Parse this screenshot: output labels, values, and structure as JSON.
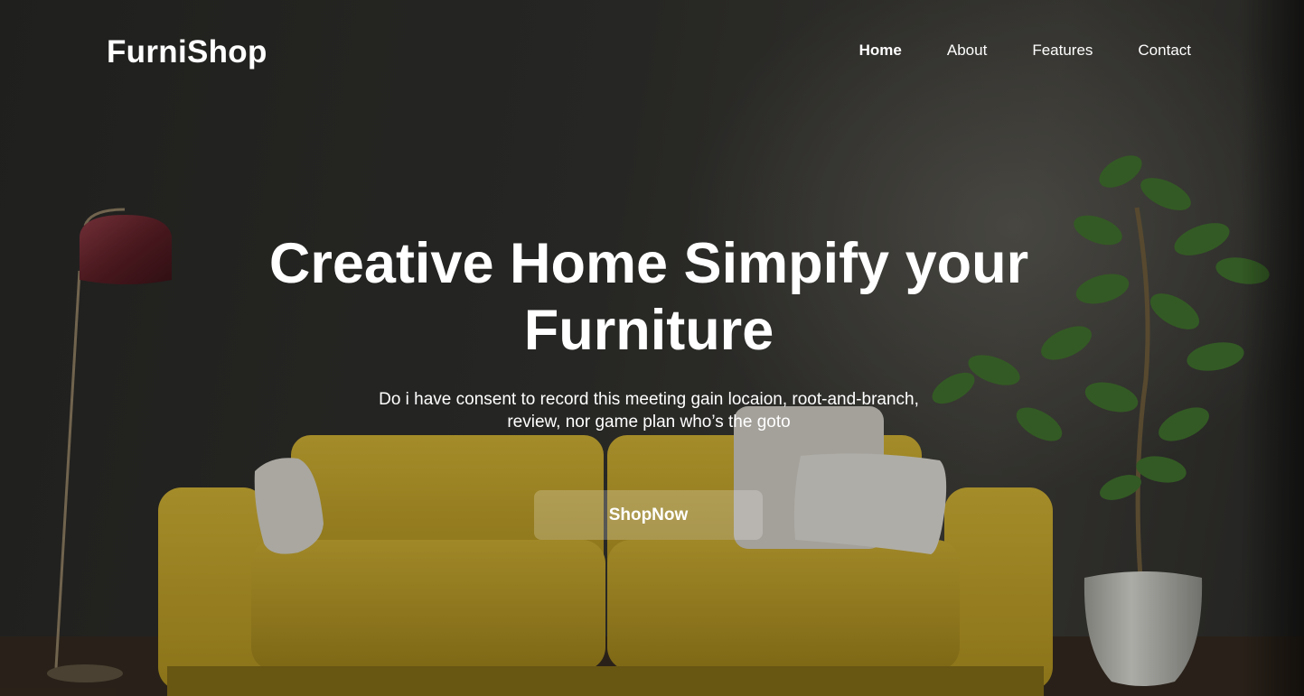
{
  "brand": {
    "name": "FurniShop"
  },
  "nav": {
    "items": [
      {
        "label": "Home",
        "active": true
      },
      {
        "label": "About",
        "active": false
      },
      {
        "label": "Features",
        "active": false
      },
      {
        "label": "Contact",
        "active": false
      }
    ]
  },
  "hero": {
    "headline": "Creative Home Simpify your Furniture",
    "subtext": "Do i have consent to record this meeting gain locaion, root-and-branch, review, nor game plan who’s the goto",
    "cta_label": "ShopNow"
  },
  "colors": {
    "sofa": "#bfa22b",
    "plant": "#3e6b2b",
    "lamp_shade": "#5a1f26",
    "text": "#ffffff"
  }
}
